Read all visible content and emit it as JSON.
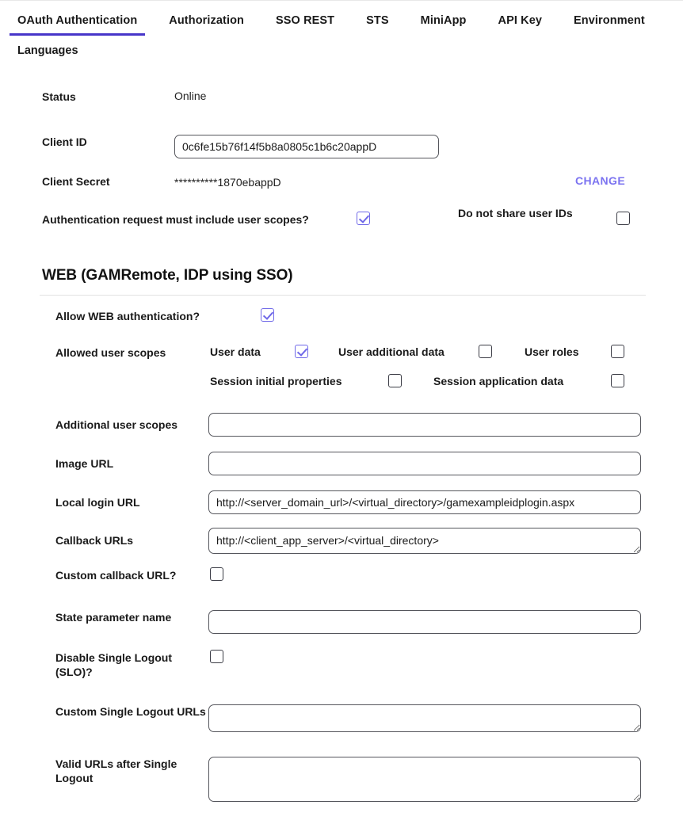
{
  "tabs": [
    {
      "label": "OAuth Authentication",
      "active": true
    },
    {
      "label": "Authorization",
      "active": false
    },
    {
      "label": "SSO REST",
      "active": false
    },
    {
      "label": "STS",
      "active": false
    },
    {
      "label": "MiniApp",
      "active": false
    },
    {
      "label": "API Key",
      "active": false
    },
    {
      "label": "Environment",
      "active": false
    }
  ],
  "subtabs": [
    {
      "label": "Languages"
    }
  ],
  "colors": {
    "active_tab_underline": "#4735c9",
    "change_link": "#7b73f0",
    "checkbox_checked": "#6f68e8",
    "checkbox_border": "#3c3d46",
    "input_border": "#55565c"
  },
  "general": {
    "status_label": "Status",
    "status_value": "Online",
    "client_id_label": "Client ID",
    "client_id_value": "0c6fe15b76f14f5b8a0805c1b6c20appD",
    "client_id_placeholder": "",
    "client_secret_label": "Client Secret",
    "client_secret_value": "**********1870ebappD",
    "change_label": "CHANGE",
    "auth_scopes_label": "Authentication request must include user scopes?",
    "auth_scopes_checked": true,
    "no_share_ids_label": "Do not share user IDs",
    "no_share_ids_checked": false
  },
  "web": {
    "section_title": "WEB (GAMRemote, IDP using SSO)",
    "allow_web_label": "Allow WEB authentication?",
    "allow_web_checked": true,
    "allowed_scopes_label": "Allowed user scopes",
    "scopes_row1": [
      {
        "label": "User data",
        "checked": true
      },
      {
        "label": "User additional data",
        "checked": false
      },
      {
        "label": "User roles",
        "checked": false
      }
    ],
    "scopes_row2": [
      {
        "label": "Session initial properties",
        "checked": false
      },
      {
        "label": "Session application data",
        "checked": false
      }
    ],
    "additional_scopes_label": "Additional user scopes",
    "additional_scopes_value": "",
    "additional_scopes_placeholder": "",
    "image_url_label": "Image URL",
    "image_url_value": "",
    "image_url_placeholder": "",
    "local_login_label": "Local login URL",
    "local_login_value": "http://<server_domain_url>/<virtual_directory>/gamexampleidplogin.aspx",
    "callback_label": "Callback URLs",
    "callback_value": "http://<client_app_server>/<virtual_directory>",
    "custom_callback_label": "Custom callback URL?",
    "custom_callback_checked": false,
    "state_param_label": "State parameter name",
    "state_param_value": "",
    "disable_slo_label": "Disable Single Logout (SLO)?",
    "disable_slo_checked": false,
    "custom_slo_label": "Custom Single Logout URLs",
    "custom_slo_value": "",
    "valid_urls_label": "Valid URLs after Single Logout",
    "valid_urls_value": ""
  }
}
